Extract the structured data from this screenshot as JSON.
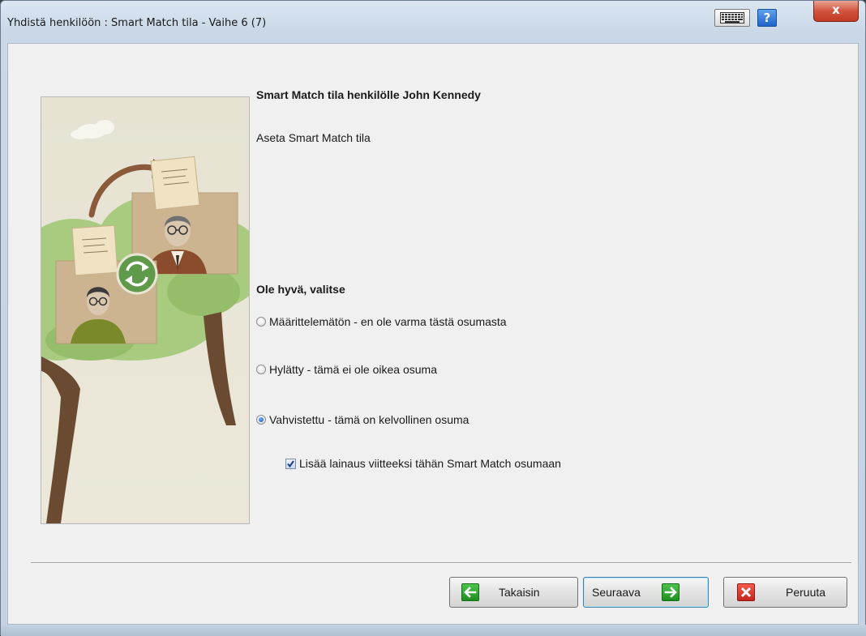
{
  "window": {
    "title": "Yhdistä henkilöön : Smart Match tila - Vaihe 6 (7)",
    "help_label": "?",
    "close_label": "x"
  },
  "content": {
    "heading": "Smart Match tila henkilölle John Kennedy",
    "subtitle": "Aseta Smart Match tila",
    "prompt": "Ole hyvä, valitse",
    "options": [
      {
        "label": "Määrittelemätön - en ole varma tästä osumasta",
        "selected": false
      },
      {
        "label": "Hylätty - tämä ei ole oikea osuma",
        "selected": false
      },
      {
        "label": "Vahvistettu - tämä on kelvollinen osuma",
        "selected": true
      }
    ],
    "citation_checkbox": {
      "label": "Lisää lainaus viitteeksi tähän Smart Match osumaan",
      "checked": true
    }
  },
  "buttons": {
    "back": "Takaisin",
    "next": "Seuraava",
    "cancel": "Peruuta"
  },
  "colors": {
    "accent_green": "#2a9d2a",
    "cancel_red": "#d6301f",
    "illustration_bg": "#e9e6d6",
    "tree_green": "#a6c97c"
  }
}
